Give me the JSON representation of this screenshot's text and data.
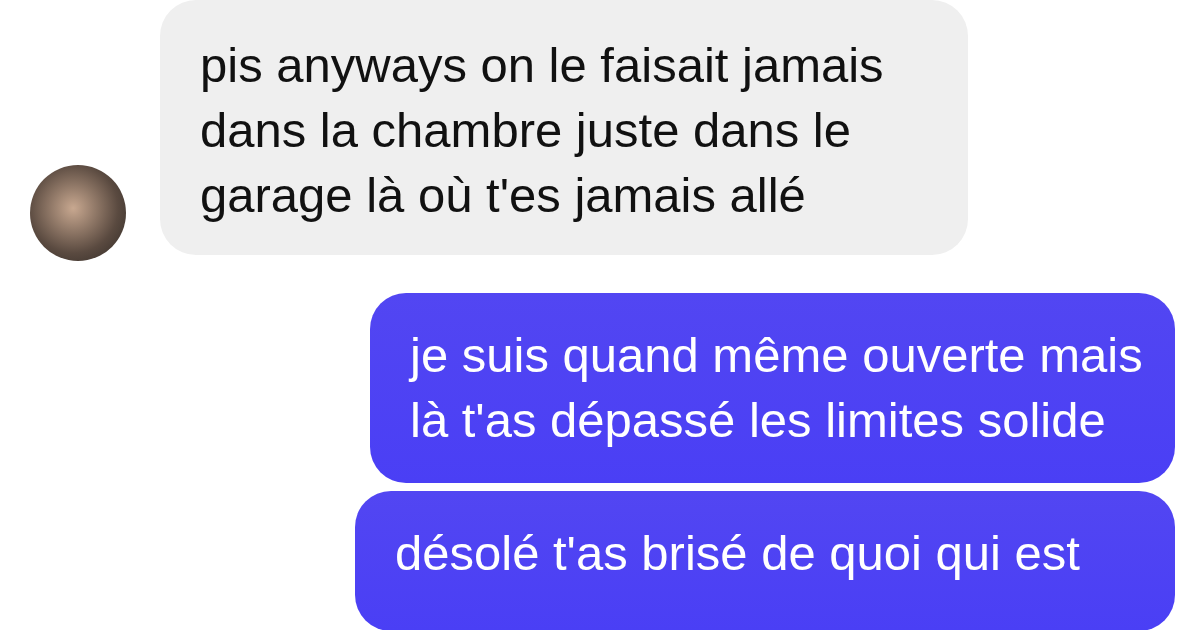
{
  "messages": [
    {
      "kind": "received",
      "text": "pis anyways on le faisait jamais dans la chambre juste dans le garage là où t'es jamais allé",
      "avatar": true
    },
    {
      "kind": "sent",
      "text": "je suis quand même ouverte mais là t'as dépassé les limites solide",
      "avatar": false
    },
    {
      "kind": "sent",
      "text": "désolé t'as brisé de quoi qui est",
      "avatar": false
    }
  ]
}
